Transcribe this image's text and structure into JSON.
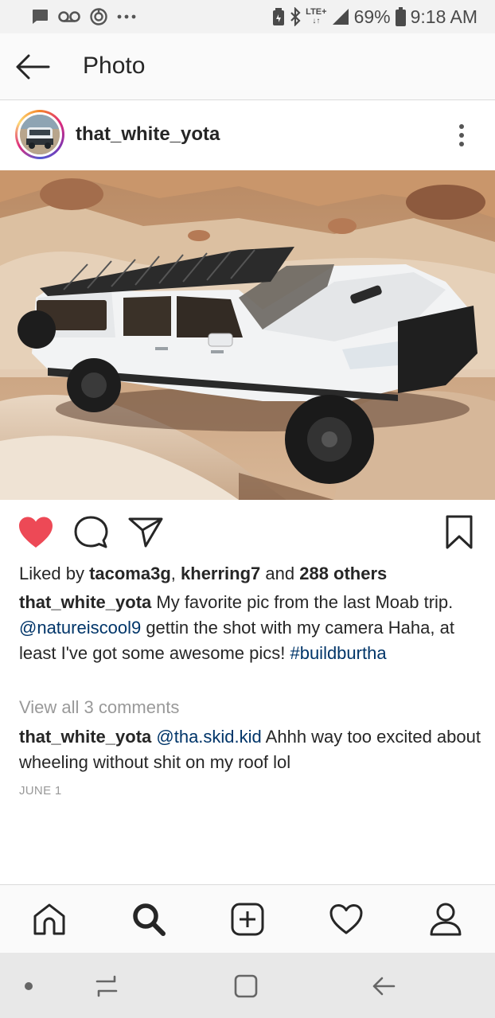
{
  "status_bar": {
    "battery_percent": "69%",
    "time": "9:18 AM",
    "network": "LTE+",
    "icons": [
      "message-icon",
      "voicemail-icon",
      "sync-icon",
      "more-notifications-icon",
      "battery-saver-icon",
      "bluetooth-icon",
      "signal-icon",
      "battery-icon"
    ]
  },
  "header": {
    "title": "Photo",
    "back_icon": "arrow-left-icon"
  },
  "post": {
    "username": "that_white_yota",
    "more_icon": "vertical-dots-icon",
    "photo_description_icon": "photo",
    "actions": {
      "like_icon": "heart-filled-icon",
      "comment_icon": "comment-icon",
      "share_icon": "send-icon",
      "save_icon": "bookmark-icon",
      "like_color": "#ed4956"
    },
    "likes": {
      "prefix": "Liked by ",
      "user1": "tacoma3g",
      "separator": ", ",
      "user2": "kherring7",
      "and": " and ",
      "others": "288 others"
    },
    "caption": {
      "username": "that_white_yota",
      "text1": " My favorite pic from the last Moab trip. ",
      "mention": "@natureiscool9",
      "text2": " gettin the shot with my camera Haha, at least I've got some awesome pics! ",
      "hashtag": "#buildburtha"
    },
    "view_all_comments": "View all 3 comments",
    "comment": {
      "username": "that_white_yota",
      "mention": "@tha.skid.kid",
      "text": " Ahhh way too excited about wheeling without shit on my roof lol"
    },
    "date": "JUNE 1",
    "link_color": "#003569"
  },
  "tab_bar": {
    "tabs": [
      {
        "name": "home",
        "icon": "home-icon"
      },
      {
        "name": "search",
        "icon": "search-icon",
        "active": true
      },
      {
        "name": "new-post",
        "icon": "plus-square-icon"
      },
      {
        "name": "activity",
        "icon": "heart-outline-icon"
      },
      {
        "name": "profile",
        "icon": "profile-icon"
      }
    ]
  },
  "nav_bar": {
    "buttons": [
      "dot-icon",
      "recents-icon",
      "home-square-icon",
      "back-arrow-icon"
    ]
  }
}
